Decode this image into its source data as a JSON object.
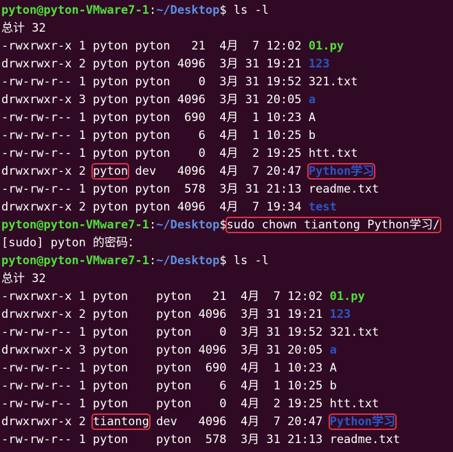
{
  "colors": {
    "background": "#300a24",
    "prompt_user": "#4fe03a",
    "prompt_path": "#5c8fe0",
    "directory": "#2a55c8",
    "executable": "#4fe03a",
    "highlight_box": "#e0304a"
  },
  "lines": [
    {
      "type": "prompt",
      "user": "pyton@pyton-VMware7-1",
      "sep": ":",
      "path": "~/Desktop",
      "sym": "$ ",
      "cmd": "ls -l",
      "highlight": false
    },
    {
      "type": "text",
      "text": "总计 32"
    },
    {
      "type": "entry",
      "pre": "-rwxrwxr-x 1 pyton pyton   21  4月  7 12:02 ",
      "name": "01.py",
      "kind": "exec"
    },
    {
      "type": "entry",
      "pre": "drwxrwxr-x 2 pyton pyton 4096  3月 31 19:21 ",
      "name": "123",
      "kind": "dir"
    },
    {
      "type": "entry",
      "pre": "-rw-rw-r-- 1 pyton pyton    0  3月 31 19:52 ",
      "name": "321.txt",
      "kind": "plain"
    },
    {
      "type": "entry",
      "pre": "drwxrwxr-x 3 pyton pyton 4096  3月 31 20:05 ",
      "name": "a",
      "kind": "dir"
    },
    {
      "type": "entry",
      "pre": "-rw-rw-r-- 1 pyton pyton  690  4月  1 10:23 ",
      "name": "A",
      "kind": "plain"
    },
    {
      "type": "entry",
      "pre": "-rw-rw-r-- 1 pyton pyton    6  4月  1 10:25 ",
      "name": "b",
      "kind": "plain"
    },
    {
      "type": "entry",
      "pre": "-rw-rw-r-- 1 pyton pyton    0  4月  2 19:25 ",
      "name": "htt.txt",
      "kind": "plain"
    },
    {
      "type": "owner",
      "pre": "drwxrwxr-x 2 ",
      "owner": "pyton",
      "post": " dev   4096  4月  7 20:47 ",
      "name": "Python学习",
      "kind": "dir"
    },
    {
      "type": "entry",
      "pre": "-rw-rw-r-- 1 pyton pyton  578  3月 31 21:13 ",
      "name": "readme.txt",
      "kind": "plain"
    },
    {
      "type": "entry",
      "pre": "drwxrwxr-x 2 pyton pyton 4096  4月  7 19:34 ",
      "name": "test",
      "kind": "dir"
    },
    {
      "type": "prompt",
      "user": "pyton@pyton-VMware7-1",
      "sep": ":",
      "path": "~/Desktop",
      "sym": "$",
      "cmd": "sudo chown tiantong Python学习/",
      "highlight": true
    },
    {
      "type": "text",
      "text": "[sudo] pyton 的密码："
    },
    {
      "type": "prompt",
      "user": "pyton@pyton-VMware7-1",
      "sep": ":",
      "path": "~/Desktop",
      "sym": "$ ",
      "cmd": "ls -l",
      "highlight": false
    },
    {
      "type": "text",
      "text": "总计 32"
    },
    {
      "type": "entry",
      "pre": "-rwxrwxr-x 1 pyton    pyton   21  4月  7 12:02 ",
      "name": "01.py",
      "kind": "exec"
    },
    {
      "type": "entry",
      "pre": "drwxrwxr-x 2 pyton    pyton 4096  3月 31 19:21 ",
      "name": "123",
      "kind": "dir"
    },
    {
      "type": "entry",
      "pre": "-rw-rw-r-- 1 pyton    pyton    0  3月 31 19:52 ",
      "name": "321.txt",
      "kind": "plain"
    },
    {
      "type": "entry",
      "pre": "drwxrwxr-x 3 pyton    pyton 4096  3月 31 20:05 ",
      "name": "a",
      "kind": "dir"
    },
    {
      "type": "entry",
      "pre": "-rw-rw-r-- 1 pyton    pyton  690  4月  1 10:23 ",
      "name": "A",
      "kind": "plain"
    },
    {
      "type": "entry",
      "pre": "-rw-rw-r-- 1 pyton    pyton    6  4月  1 10:25 ",
      "name": "b",
      "kind": "plain"
    },
    {
      "type": "entry",
      "pre": "-rw-rw-r-- 1 pyton    pyton    0  4月  2 19:25 ",
      "name": "htt.txt",
      "kind": "plain"
    },
    {
      "type": "owner",
      "pre": "drwxrwxr-x 2 ",
      "owner": "tiantong",
      "post": " dev   4096  4月  7 20:47 ",
      "name": "Python学习",
      "kind": "dir"
    },
    {
      "type": "entry",
      "pre": "-rw-rw-r-- 1 pyton    pyton  578  3月 31 21:13 ",
      "name": "readme.txt",
      "kind": "plain"
    }
  ]
}
